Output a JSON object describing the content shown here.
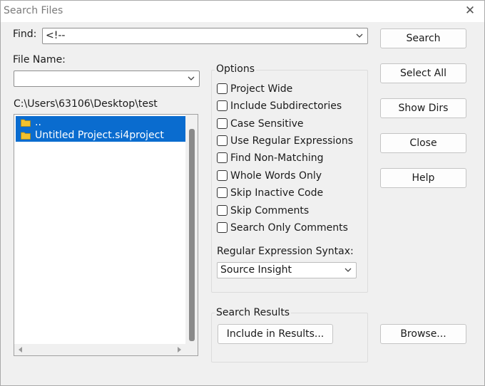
{
  "window": {
    "title": "Search Files"
  },
  "find": {
    "label": "Find:",
    "value": "<!--"
  },
  "file_name": {
    "label": "File Name:",
    "value": ""
  },
  "path": "C:\\Users\\63106\\Desktop\\test",
  "file_list": {
    "items": [
      {
        "label": ".."
      },
      {
        "label": "Untitled Project.si4project"
      }
    ]
  },
  "options": {
    "title": "Options",
    "checkboxes": [
      {
        "label": "Project Wide",
        "checked": false
      },
      {
        "label": "Include Subdirectories",
        "checked": false
      },
      {
        "label": "Case Sensitive",
        "checked": false
      },
      {
        "label": "Use Regular Expressions",
        "checked": false
      },
      {
        "label": "Find Non-Matching",
        "checked": false
      },
      {
        "label": "Whole Words Only",
        "checked": false
      },
      {
        "label": "Skip Inactive Code",
        "checked": false
      },
      {
        "label": "Skip Comments",
        "checked": false
      },
      {
        "label": "Search Only Comments",
        "checked": false
      }
    ],
    "regex_syntax_label": "Regular Expression Syntax:",
    "regex_syntax_value": "Source Insight"
  },
  "search_results": {
    "title": "Search Results",
    "include_button": "Include in Results..."
  },
  "buttons": {
    "search": "Search",
    "select_all": "Select All",
    "show_dirs": "Show Dirs",
    "close": "Close",
    "help": "Help",
    "browse": "Browse..."
  },
  "icons": {
    "close": "close-icon",
    "dropdown": "chevron-down-icon",
    "folder": "folder-icon",
    "scroll_left": "arrow-left-icon",
    "scroll_right": "arrow-right-icon"
  },
  "colors": {
    "selection": "#0a6ccf",
    "folder": "#f2c12e",
    "window_bg": "#f0f0f0"
  }
}
